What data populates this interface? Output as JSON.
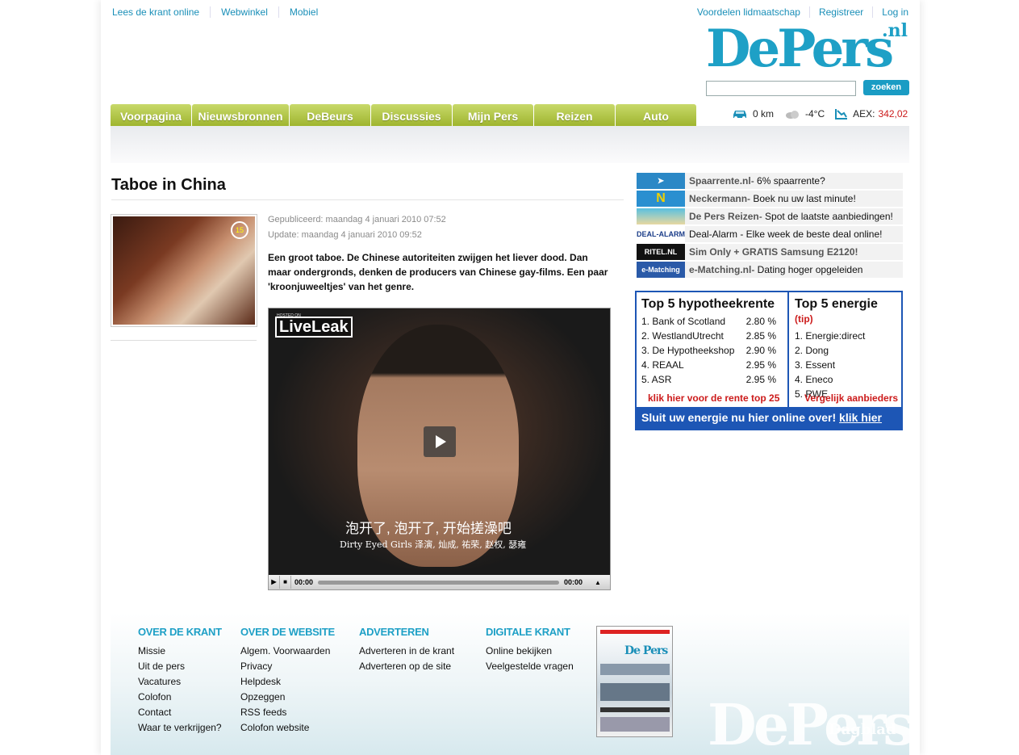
{
  "top_links": [
    "Lees de krant online",
    "Webwinkel",
    "Mobiel"
  ],
  "top_right_links": [
    "Voordelen lidmaatschap",
    "Registreer",
    "Log in"
  ],
  "logo": {
    "text": "DePers",
    "suffix": ".nl"
  },
  "search": {
    "button": "zoeken",
    "placeholder": ""
  },
  "nav": [
    "Voorpagina",
    "Nieuwsbronnen",
    "DeBeurs",
    "Discussies",
    "Mijn Pers",
    "Reizen",
    "Auto"
  ],
  "info": {
    "traffic": "0 km",
    "weather": "-4°C",
    "aex_label": "AEX:",
    "aex_value": "342,02"
  },
  "article": {
    "title": "Taboe in China",
    "published": "Gepubliceerd: maandag 4 januari 2010 07:52",
    "updated": "Update: maandag 4 januari 2010 09:52",
    "lead": "Een groot taboe. De Chinese autoriteiten zwijgen het liever dood. Dan maar ondergronds, denken de producers van Chinese gay-films. Een paar 'kroonjuweeltjes' van het genre.",
    "thumb_badge": "15"
  },
  "video": {
    "hosted": "HOSTED ON",
    "brand": "LiveLeak",
    "subtitle_cn": "泡开了, 泡开了, 开始搓澡吧",
    "subtitle_en": "Dirty Eyed Girls  泽演, 灿成, 祐荣, 赵权, 瑟雍",
    "time_current": "00:00",
    "time_total": "00:00"
  },
  "ads": [
    {
      "name": "Spaarrente.nl",
      "text": " - 6% spaarrente?",
      "logo": "",
      "color": "#2b88c6"
    },
    {
      "name": "Neckermann",
      "text": " - Boek nu uw last minute!",
      "logo": "N",
      "color": "#2a8fd0"
    },
    {
      "name": "De Pers Reizen",
      "text": " - Spot de laatste aanbiedingen!",
      "logo": "",
      "color": "#3aa5b8"
    },
    {
      "name": "",
      "text": "Deal-Alarm - Elke week de beste deal online!",
      "logo": "DEAL-ALARM",
      "color": "#1a3c88"
    },
    {
      "name": "Sim Only + GRATIS Samsung E2120!",
      "text": "",
      "logo": "RITEL.NL",
      "color": "#111111"
    },
    {
      "name": "e-Matching.nl",
      "text": " - Dating hoger opgeleiden",
      "logo": "e-Matching",
      "color": "#2a5aa8"
    }
  ],
  "hypotheek": {
    "title": "Top 5 hypotheekrente",
    "rows": [
      {
        "name": "1. Bank of Scotland",
        "value": "2.80 %"
      },
      {
        "name": "2. WestlandUtrecht",
        "value": "2.85 %"
      },
      {
        "name": "3. De Hypotheekshop",
        "value": "2.90 %"
      },
      {
        "name": "4. REAAL",
        "value": "2.95 %"
      },
      {
        "name": "5. ASR",
        "value": "2.95 %"
      }
    ],
    "link": "klik hier voor de rente top 25"
  },
  "energie": {
    "title": "Top 5 energie",
    "tip": "(tip)",
    "rows": [
      "1. Energie:direct",
      "2. Dong",
      "3. Essent",
      "4. Eneco",
      "5. RWE"
    ],
    "link": "Vergelijk aanbieders"
  },
  "energy_banner": {
    "text": "Sluit uw energie nu hier online over! ",
    "link": "klik hier"
  },
  "footer": {
    "cols": [
      {
        "title": "OVER DE KRANT",
        "items": [
          "Missie",
          "Uit de pers",
          "Vacatures",
          "Colofon",
          "Contact",
          "Waar te verkrijgen?"
        ]
      },
      {
        "title": "OVER DE WEBSITE",
        "items": [
          "Algem. Voorwaarden",
          "Privacy",
          "Helpdesk",
          "Opzeggen",
          "RSS feeds",
          "Colofon website"
        ]
      },
      {
        "title": "ADVERTEREN",
        "items": [
          "Adverteren in de krant",
          "Adverteren op de site"
        ]
      },
      {
        "title": "DIGITALE KRANT",
        "items": [
          "Online bekijken",
          "Veelgestelde vragen"
        ]
      }
    ],
    "cover_logo": "De Pers",
    "watermark": "DePers",
    "watermark_small": "Dagblad"
  }
}
